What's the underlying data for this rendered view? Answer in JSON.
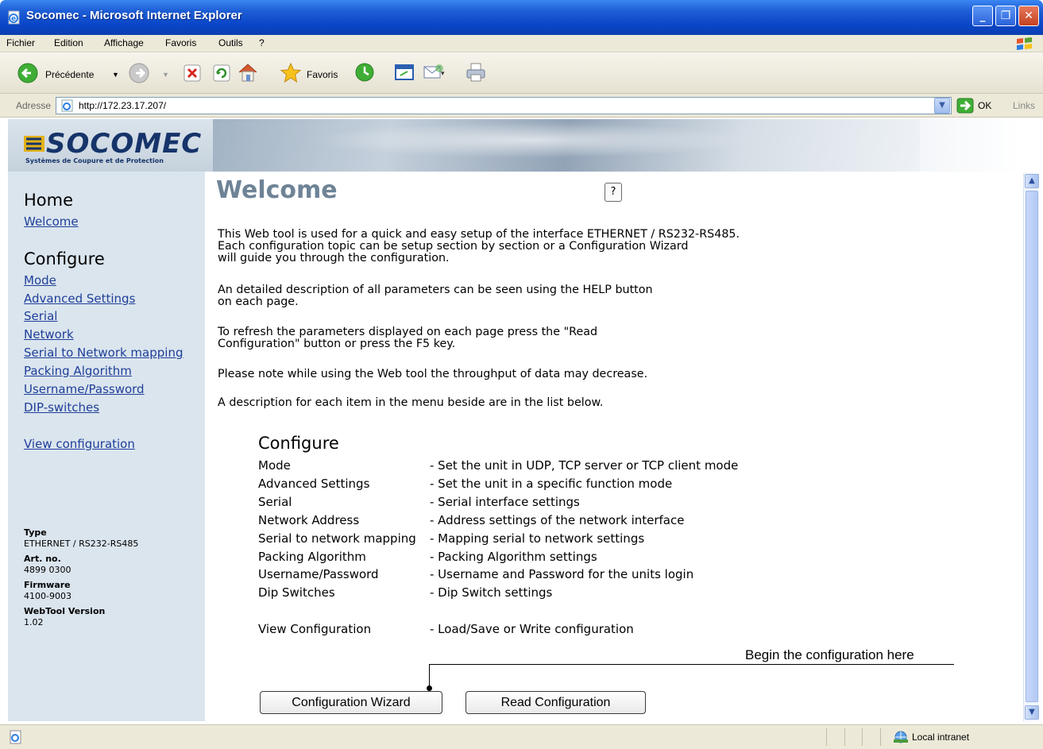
{
  "window": {
    "title": "Socomec - Microsoft Internet Explorer",
    "minimize": "_",
    "maximize": "❐",
    "close": "✕"
  },
  "menu": [
    "Fichier",
    "Edition",
    "Affichage",
    "Favoris",
    "Outils",
    "?"
  ],
  "toolbar": {
    "back_label": "Précédente",
    "favorites_label": "Favoris"
  },
  "address": {
    "label": "Adresse",
    "url": "http://172.23.17.207/",
    "go_label": "OK",
    "links_label": "Links"
  },
  "banner": {
    "logo_text": "SOCOMEC",
    "logo_tagline": "Systèmes de Coupure et de Protection"
  },
  "sidebar": {
    "home_heading": "Home",
    "home_links": [
      "Welcome"
    ],
    "configure_heading": "Configure",
    "configure_links": [
      "Mode",
      "Advanced Settings",
      "Serial",
      "Network",
      "Serial to Network mapping",
      "Packing Algorithm",
      "Username/Password",
      "DIP-switches"
    ],
    "view_link": "View configuration",
    "info": [
      {
        "label": "Type",
        "value": "ETHERNET / RS232-RS485"
      },
      {
        "label": "Art. no.",
        "value": "4899 0300"
      },
      {
        "label": "Firmware",
        "value": "4100-9003"
      },
      {
        "label": "WebTool Version",
        "value": "1.02"
      }
    ]
  },
  "main": {
    "title": "Welcome",
    "help_label": "?",
    "paragraphs": [
      [
        "This Web tool is used for a quick and easy setup of the interface ETHERNET / RS232-RS485.",
        "Each configuration topic can be setup section by section or a Configuration Wizard",
        "will guide you through the configuration."
      ],
      [
        "An detailed description of all parameters can be seen using the HELP button",
        "on each page."
      ],
      [
        "To refresh the parameters displayed on each page press the \"Read",
        "Configuration\" button or press the F5 key."
      ],
      [
        "Please note while using the Web tool the throughput of data may decrease."
      ],
      [
        "A description for each item in the menu beside are in the list below."
      ]
    ],
    "configure_heading": "Configure",
    "configure_items": [
      {
        "name": "Mode",
        "desc": "- Set the unit in UDP, TCP server or TCP client mode"
      },
      {
        "name": "Advanced Settings",
        "desc": "- Set the unit in a specific function mode"
      },
      {
        "name": "Serial",
        "desc": "- Serial interface settings"
      },
      {
        "name": "Network Address",
        "desc": "- Address settings of the network interface"
      },
      {
        "name": "Serial to network mapping",
        "desc": "- Mapping serial to network settings"
      },
      {
        "name": "Packing Algorithm",
        "desc": "- Packing Algorithm settings"
      },
      {
        "name": "Username/Password",
        "desc": "- Username and Password for the units login"
      },
      {
        "name": "Dip Switches",
        "desc": "- Dip Switch settings"
      }
    ],
    "view_item": {
      "name": "View Configuration",
      "desc": "- Load/Save or Write configuration"
    },
    "annotation": "Begin the configuration here",
    "wizard_button": "Configuration Wizard",
    "read_button": "Read Configuration"
  },
  "status": {
    "zone": "Local intranet"
  }
}
